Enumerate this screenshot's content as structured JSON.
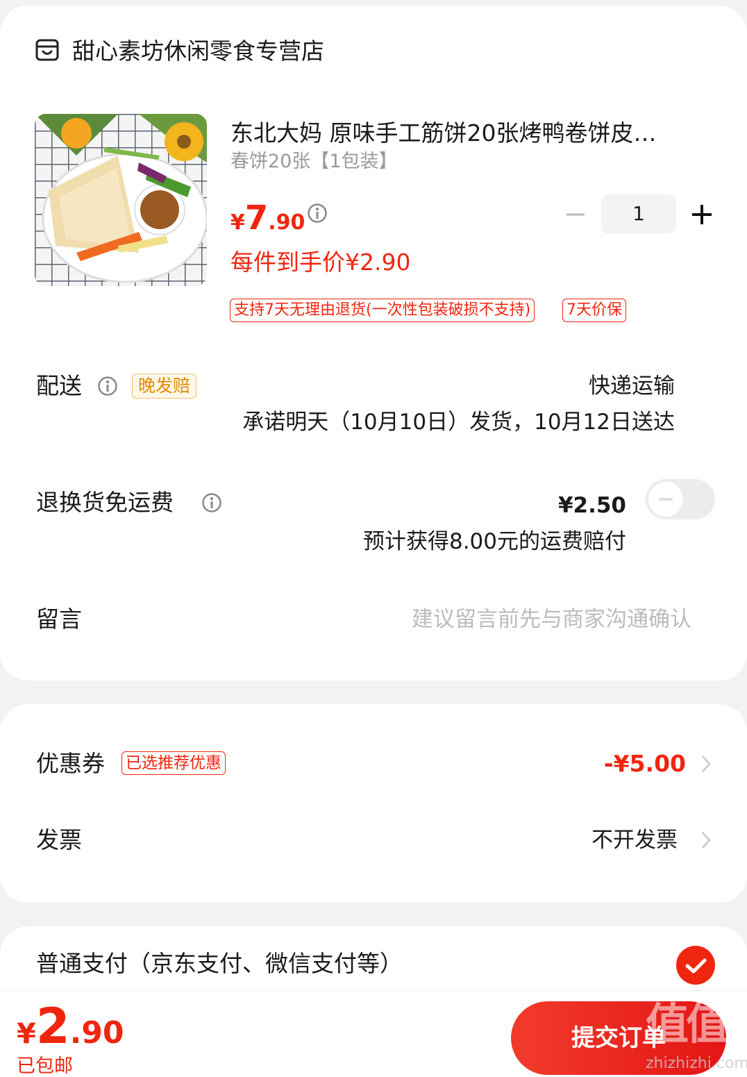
{
  "store": {
    "name": "甜心素坊休闲零食专营店",
    "icon": "store-icon"
  },
  "product": {
    "title": "东北大妈 原味手工筋饼20张烤鸭卷饼皮…",
    "spec": "春饼20张【1包装】",
    "price_symbol": "¥",
    "price_int": "7",
    "price_dec": ".90",
    "unit_price": "每件到手价¥2.90",
    "quantity": "1",
    "tags": [
      "支持7天无理由退货(一次性包装破损不支持)",
      "7天价保"
    ]
  },
  "delivery": {
    "label": "配送",
    "badge": "晚发赔",
    "method": "快递运输",
    "promise": "承诺明天（10月10日）发货，10月12日送达"
  },
  "return_shipping": {
    "label": "退换货免运费",
    "price": "¥2.50",
    "note": "预计获得8.00元的运费赔付",
    "enabled": false
  },
  "message": {
    "label": "留言",
    "placeholder": "建议留言前先与商家沟通确认"
  },
  "coupon": {
    "label": "优惠券",
    "badge": "已选推荐优惠",
    "value": "-¥5.00"
  },
  "invoice": {
    "label": "发票",
    "value": "不开发票"
  },
  "payment": {
    "label": "普通支付（京东支付、微信支付等）",
    "selected": true
  },
  "footer": {
    "total_symbol": "¥",
    "total_int": "2",
    "total_dec": ".90",
    "shipping_note": "已包邮",
    "submit_label": "提交订单",
    "watermark": "值值值",
    "watermark_sub": "zhizhizhi.com"
  },
  "colors": {
    "accent": "#f0250f",
    "orange": "#e08a00",
    "background": "#f2f2f2"
  }
}
